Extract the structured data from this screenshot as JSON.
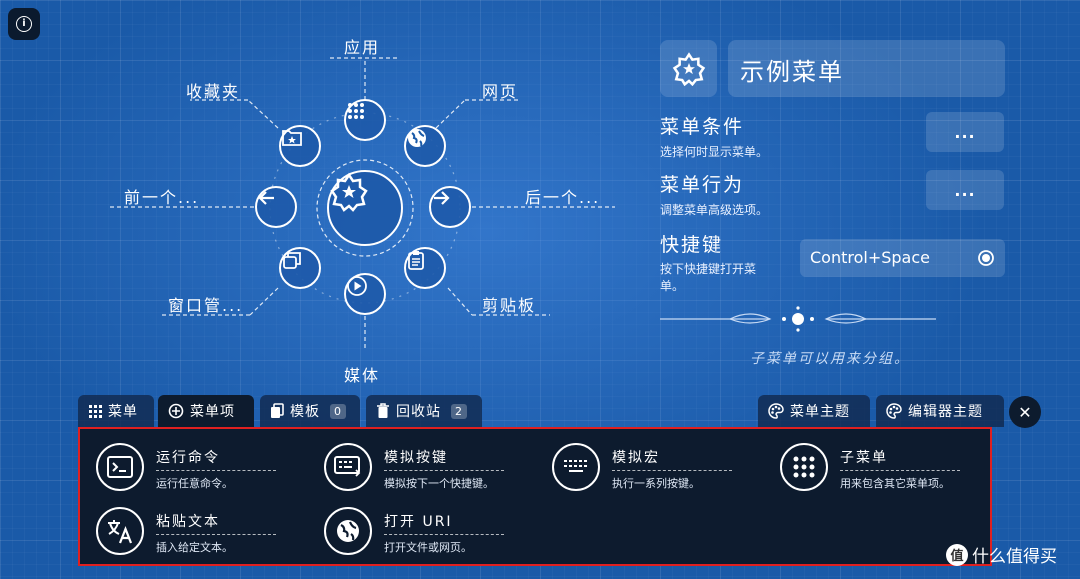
{
  "radial": {
    "labels": {
      "top": "应用",
      "top_left": "收藏夹",
      "top_right": "网页",
      "left": "前一个...",
      "right": "后一个...",
      "bottom_left": "窗口管...",
      "bottom_right": "剪贴板",
      "bottom": "媒体"
    }
  },
  "menu": {
    "name": "示例菜单",
    "conditions_title": "菜单条件",
    "conditions_desc": "选择何时显示菜单。",
    "behavior_title": "菜单行为",
    "behavior_desc": "调整菜单高级选项。",
    "more_label": "...",
    "shortcut_title": "快捷键",
    "shortcut_desc_1": "按下快捷键打开菜",
    "shortcut_desc_2": "单。",
    "shortcut_value": "Control+Space",
    "submenu_note": "子菜单可以用来分组。"
  },
  "tabs": [
    {
      "label": "菜单"
    },
    {
      "label": "菜单项"
    },
    {
      "label": "模板",
      "count": "0"
    },
    {
      "label": "回收站",
      "count": "2"
    },
    {
      "label": "菜单主题"
    },
    {
      "label": "编辑器主题"
    }
  ],
  "items": [
    {
      "title": "运行命令",
      "desc": "运行任意命令。",
      "icon": "terminal-icon"
    },
    {
      "title": "模拟按键",
      "desc": "模拟按下一个快捷键。",
      "icon": "keyboard-icon"
    },
    {
      "title": "模拟宏",
      "desc": "执行一系列按键。",
      "icon": "keyboard-macro-icon"
    },
    {
      "title": "子菜单",
      "desc": "用来包含其它菜单项。",
      "icon": "grid-icon"
    },
    {
      "title": "粘贴文本",
      "desc": "插入给定文本。",
      "icon": "translate-icon"
    },
    {
      "title": "打开 URI",
      "desc": "打开文件或网页。",
      "icon": "globe-icon"
    }
  ],
  "watermark": {
    "badge": "值",
    "text": "什么值得买"
  },
  "colors": {
    "background": "#1a5aa8",
    "panel": "#0d1b2e",
    "highlight_border": "#e02020"
  }
}
